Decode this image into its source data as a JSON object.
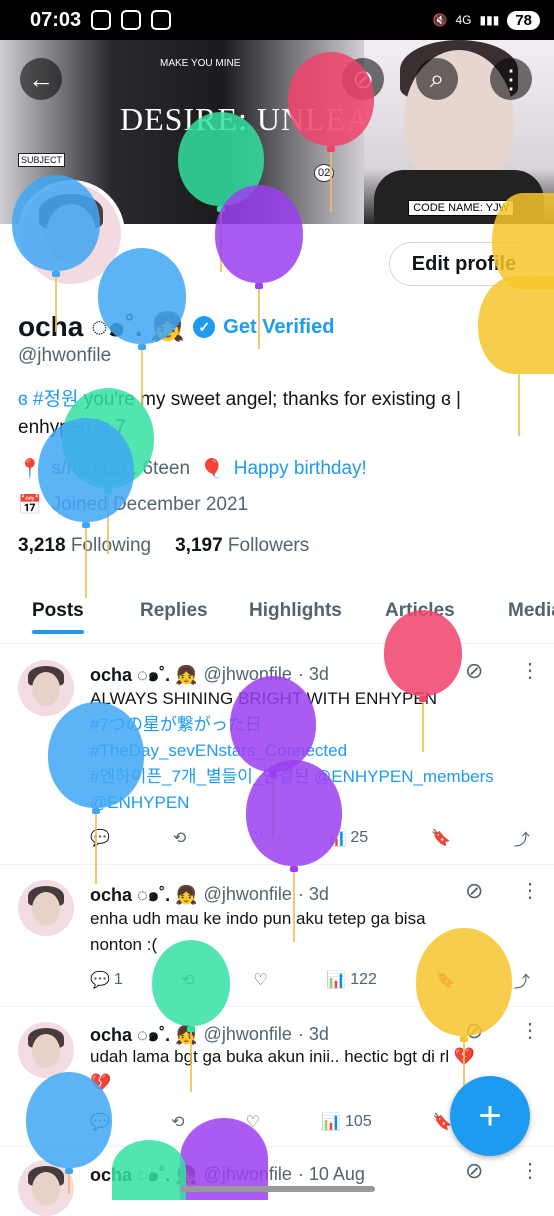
{
  "status_bar": {
    "time": "07:03",
    "network": "4G",
    "battery": "78"
  },
  "banner": {
    "poster_top": "MAKE YOU MINE",
    "poster_title": "DESIRE: UNLEASH",
    "subject": "SUBJECT",
    "number": "02",
    "code_name": "CODE NAME: YJW"
  },
  "header": {
    "back": "←",
    "search": "⌕",
    "more": "⋮"
  },
  "profile": {
    "edit_label": "Edit profile",
    "name": "ocha ◌๑˚. 👧",
    "get_verified": "Get Verified",
    "handle": "@jhwonfile",
    "bio_tag": "ɞ #정원",
    "bio_text": " you're my sweet angel; thanks for existing ɞ | enhypen is 7",
    "location": "s/he (12) . 6teen",
    "website": "Happy birthday!",
    "joined": "Joined December 2021",
    "following_count": "3,218",
    "following_label": "Following",
    "followers_count": "3,197",
    "followers_label": "Followers"
  },
  "tabs": [
    "Posts",
    "Replies",
    "Highlights",
    "Articles",
    "Media"
  ],
  "posts": [
    {
      "name": "ocha ◌๑˚. 👧",
      "handle": "@jhwonfile",
      "time": "· 3d",
      "line1": "ALWAYS SHINING BRIGHT WITH ENHYPEN",
      "line2": "#7つの星が繋がった日",
      "line3": "#TheDay_sevENstars_Connected",
      "line4": "#엔하이픈_7개_별들이_연결된 @ENHYPEN_members",
      "line5": "@ENHYPEN",
      "views": "25"
    },
    {
      "name": "ocha ◌๑˚. 👧",
      "handle": "@jhwonfile",
      "time": "· 3d",
      "line1": "enha udh mau ke indo pun aku tetep ga bisa",
      "line2": "nonton :(",
      "replies": "1",
      "views": "122"
    },
    {
      "name": "ocha ◌๑˚. 👧",
      "handle": "@jhwonfile",
      "time": "· 3d",
      "line1": "udah lama bgt ga buka akun inii.. hectic bgt di rl 💔",
      "line2": "💔",
      "views": "105"
    },
    {
      "name": "ocha ◌๑˚. 👧",
      "handle": "@jhwonfile",
      "time": "· 10 Aug"
    }
  ],
  "colors": {
    "accent": "#1d9bf0",
    "balloon_blue": "#3fa7f5",
    "balloon_purple": "#9b3ff0",
    "balloon_green": "#34e0a1",
    "balloon_pink": "#f0426b",
    "balloon_yellow": "#f5c52b"
  },
  "icons": {
    "reply": "💬",
    "repost": "⟲",
    "like": "♡",
    "views": "📊",
    "bookmark": "🔖",
    "share": "⤴",
    "grok": "⊘",
    "location": "📍",
    "balloon": "🎈",
    "calendar": "📅",
    "compose": "+"
  }
}
